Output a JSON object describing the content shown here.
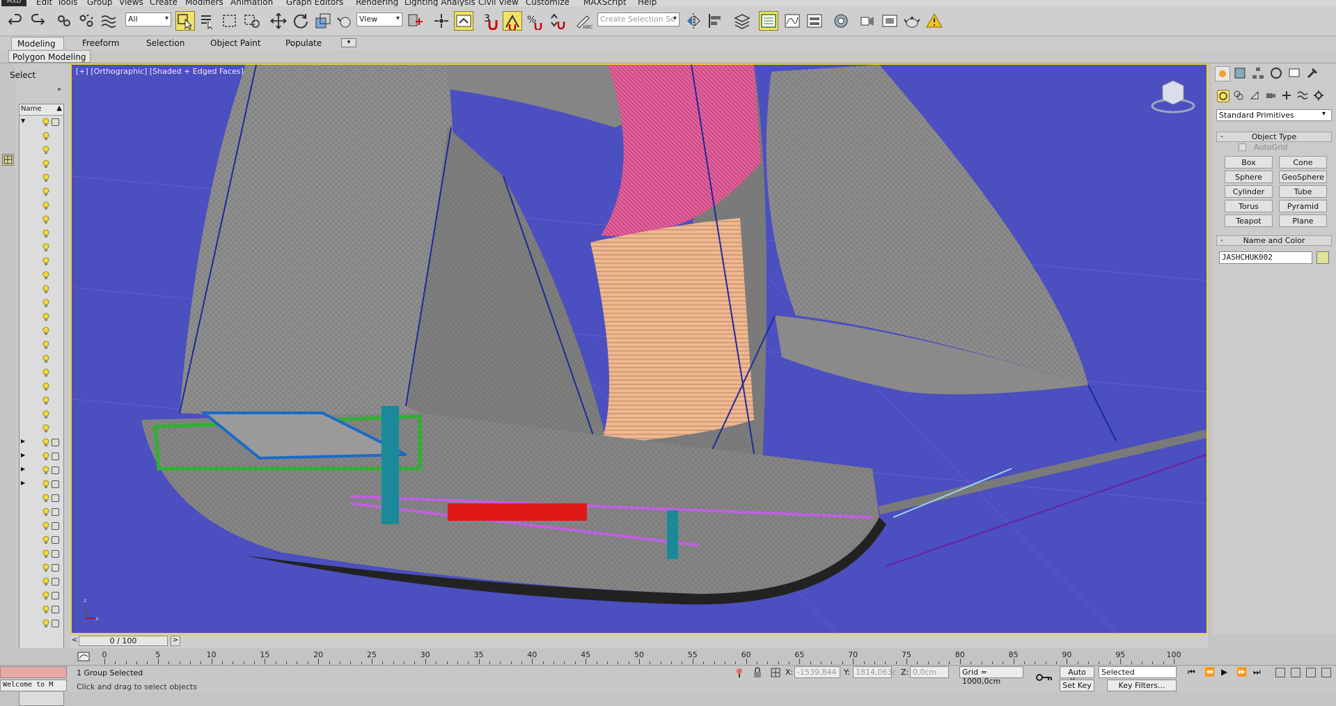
{
  "menu": {
    "logo": "MXD",
    "items": [
      "Edit",
      "Tools",
      "Group",
      "Views",
      "Create",
      "Modifiers",
      "Animation",
      "Graph Editors",
      "Rendering",
      "Lighting Analysis",
      "Civil View",
      "Customize",
      "MAXScript",
      "Help"
    ]
  },
  "toolbar": {
    "filter_value": "All",
    "refcoord_value": "View",
    "snap_label": "3",
    "selection_set_placeholder": "Create Selection Se"
  },
  "ribbon": {
    "tabs": [
      "Modeling",
      "Freeform",
      "Selection",
      "Object Paint",
      "Populate"
    ],
    "active_tab": "Modeling",
    "subpanel": "Polygon Modeling"
  },
  "scene_explorer": {
    "select_label": "Select",
    "column_name": "Name"
  },
  "viewport": {
    "label": "[+] [Orthographic] [Shaded + Edged Faces]",
    "colors": {
      "background": "#4c4fbf",
      "border": "#e8d33a"
    }
  },
  "command_panel": {
    "dropdown": "Standard Primitives",
    "object_type_title": "Object Type",
    "autogrid_label": "AutoGrid",
    "primitives": [
      "Box",
      "Cone",
      "Sphere",
      "GeoSphere",
      "Cylinder",
      "Tube",
      "Torus",
      "Pyramid",
      "Teapot",
      "Plane"
    ],
    "name_color_title": "Name and Color",
    "object_name": "JASHCHUK002",
    "object_color": "#dfe39a"
  },
  "timeline": {
    "frame_display": "0 / 100",
    "ticks": [
      "0",
      "5",
      "10",
      "15",
      "20",
      "25",
      "30",
      "35",
      "40",
      "45",
      "50",
      "55",
      "60",
      "65",
      "70",
      "75",
      "80",
      "85",
      "90",
      "95",
      "100"
    ]
  },
  "statusbar": {
    "selection_text": "1 Group Selected",
    "x_label": "X:",
    "x_value": "-1539,844",
    "y_label": "Y:",
    "y_value": "1814,063c",
    "z_label": "Z:",
    "z_value": "0,0cm",
    "grid": "Grid = 1000,0cm",
    "autokey_label": "Auto Key",
    "keyfilter_value": "Selected",
    "setkey_label": "Set Key",
    "keyfilters_label": "Key Filters...",
    "prompt_text": "Welcome to M",
    "hint_text": "Click and drag to select objects"
  }
}
